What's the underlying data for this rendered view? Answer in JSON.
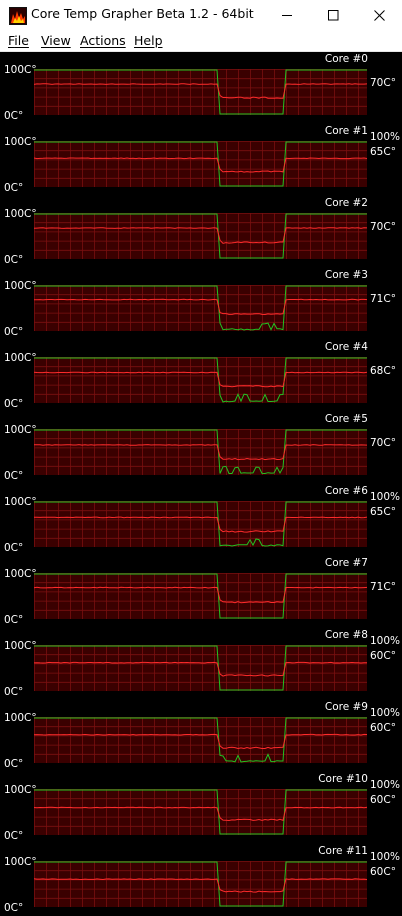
{
  "window": {
    "title": "Core Temp Grapher Beta 1.2 - 64bit",
    "icon": "core-temp-flame-icon",
    "controls": [
      "minimize-icon",
      "maximize-icon",
      "close-icon"
    ]
  },
  "menu": [
    "File",
    "View",
    "Actions",
    "Help"
  ],
  "colors": {
    "background": "#000000",
    "plot_background": "#3a0000",
    "grid": "#7a1010",
    "temperature_line": "#ff2b2b",
    "load_line": "#22c322",
    "axis_text": "#ffffff"
  },
  "axis": {
    "max_label": "100C°",
    "min_label": "0C°"
  },
  "graphs": [
    {
      "core": "Core #0",
      "load": "",
      "temp": "70C°",
      "temp_level": 68,
      "temp_dip": 37,
      "load_burst": false
    },
    {
      "core": "Core #1",
      "load": "100%",
      "temp": "65C°",
      "temp_level": 63,
      "temp_dip": 33,
      "load_burst": false
    },
    {
      "core": "Core #2",
      "load": "",
      "temp": "70C°",
      "temp_level": 68,
      "temp_dip": 35,
      "load_burst": false
    },
    {
      "core": "Core #3",
      "load": "",
      "temp": "71C°",
      "temp_level": 69,
      "temp_dip": 36,
      "load_burst": true
    },
    {
      "core": "Core #4",
      "load": "",
      "temp": "68C°",
      "temp_level": 67,
      "temp_dip": 36,
      "load_burst": true
    },
    {
      "core": "Core #5",
      "load": "",
      "temp": "70C°",
      "temp_level": 66,
      "temp_dip": 34,
      "load_burst": true
    },
    {
      "core": "Core #6",
      "load": "100%",
      "temp": "65C°",
      "temp_level": 65,
      "temp_dip": 33,
      "load_burst": true
    },
    {
      "core": "Core #7",
      "load": "",
      "temp": "71C°",
      "temp_level": 69,
      "temp_dip": 36,
      "load_burst": false
    },
    {
      "core": "Core #8",
      "load": "100%",
      "temp": "60C°",
      "temp_level": 62,
      "temp_dip": 33,
      "load_burst": false
    },
    {
      "core": "Core #9",
      "load": "100%",
      "temp": "60C°",
      "temp_level": 62,
      "temp_dip": 32,
      "load_burst": true
    },
    {
      "core": "Core #10",
      "load": "100%",
      "temp": "60C°",
      "temp_level": 60,
      "temp_dip": 32,
      "load_burst": false
    },
    {
      "core": "Core #11",
      "load": "100%",
      "temp": "60C°",
      "temp_level": 61,
      "temp_dip": 33,
      "load_burst": false
    }
  ]
}
